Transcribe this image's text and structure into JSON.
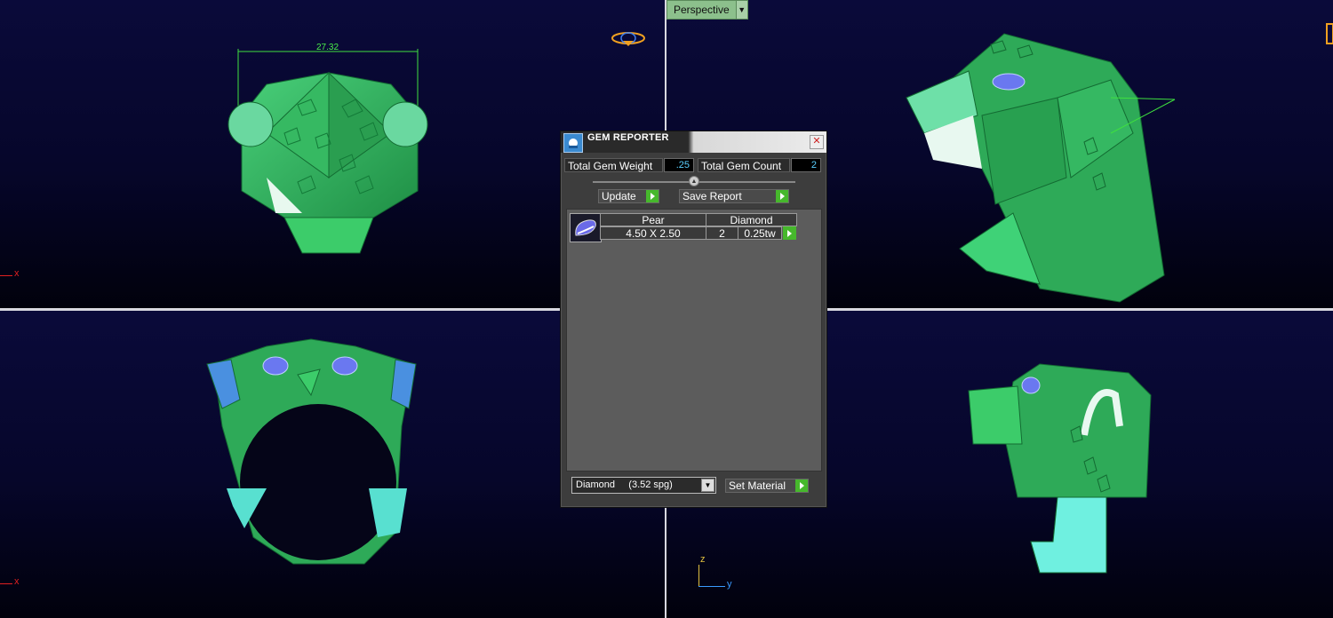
{
  "viewports": {
    "top_left": {
      "dimension_value": "27.32",
      "axis_label": "x"
    },
    "top_right": {
      "view_label": "Perspective"
    },
    "bottom_left": {
      "axis_label": "x"
    },
    "bottom_right": {
      "axis_z_label": "z",
      "axis_y_label": "y"
    }
  },
  "gem_reporter": {
    "title": "GEM REPORTER",
    "total_gem_weight_label": "Total Gem Weight",
    "total_gem_weight_value": ".25",
    "total_gem_count_label": "Total Gem Count",
    "total_gem_count_value": "2",
    "update_label": "Update",
    "save_report_label": "Save Report",
    "gems": [
      {
        "shape": "Pear",
        "material": "Diamond",
        "size": "4.50 X 2.50",
        "count": "2",
        "weight": "0.25tw"
      }
    ],
    "material_select": "Diamond     (3.52 spg)",
    "set_material_label": "Set Material"
  },
  "colors": {
    "model_green": "#2fb85a",
    "model_cyan": "#6ff0e0",
    "background": "#0a0a3a",
    "accent_green": "#46b82c"
  }
}
